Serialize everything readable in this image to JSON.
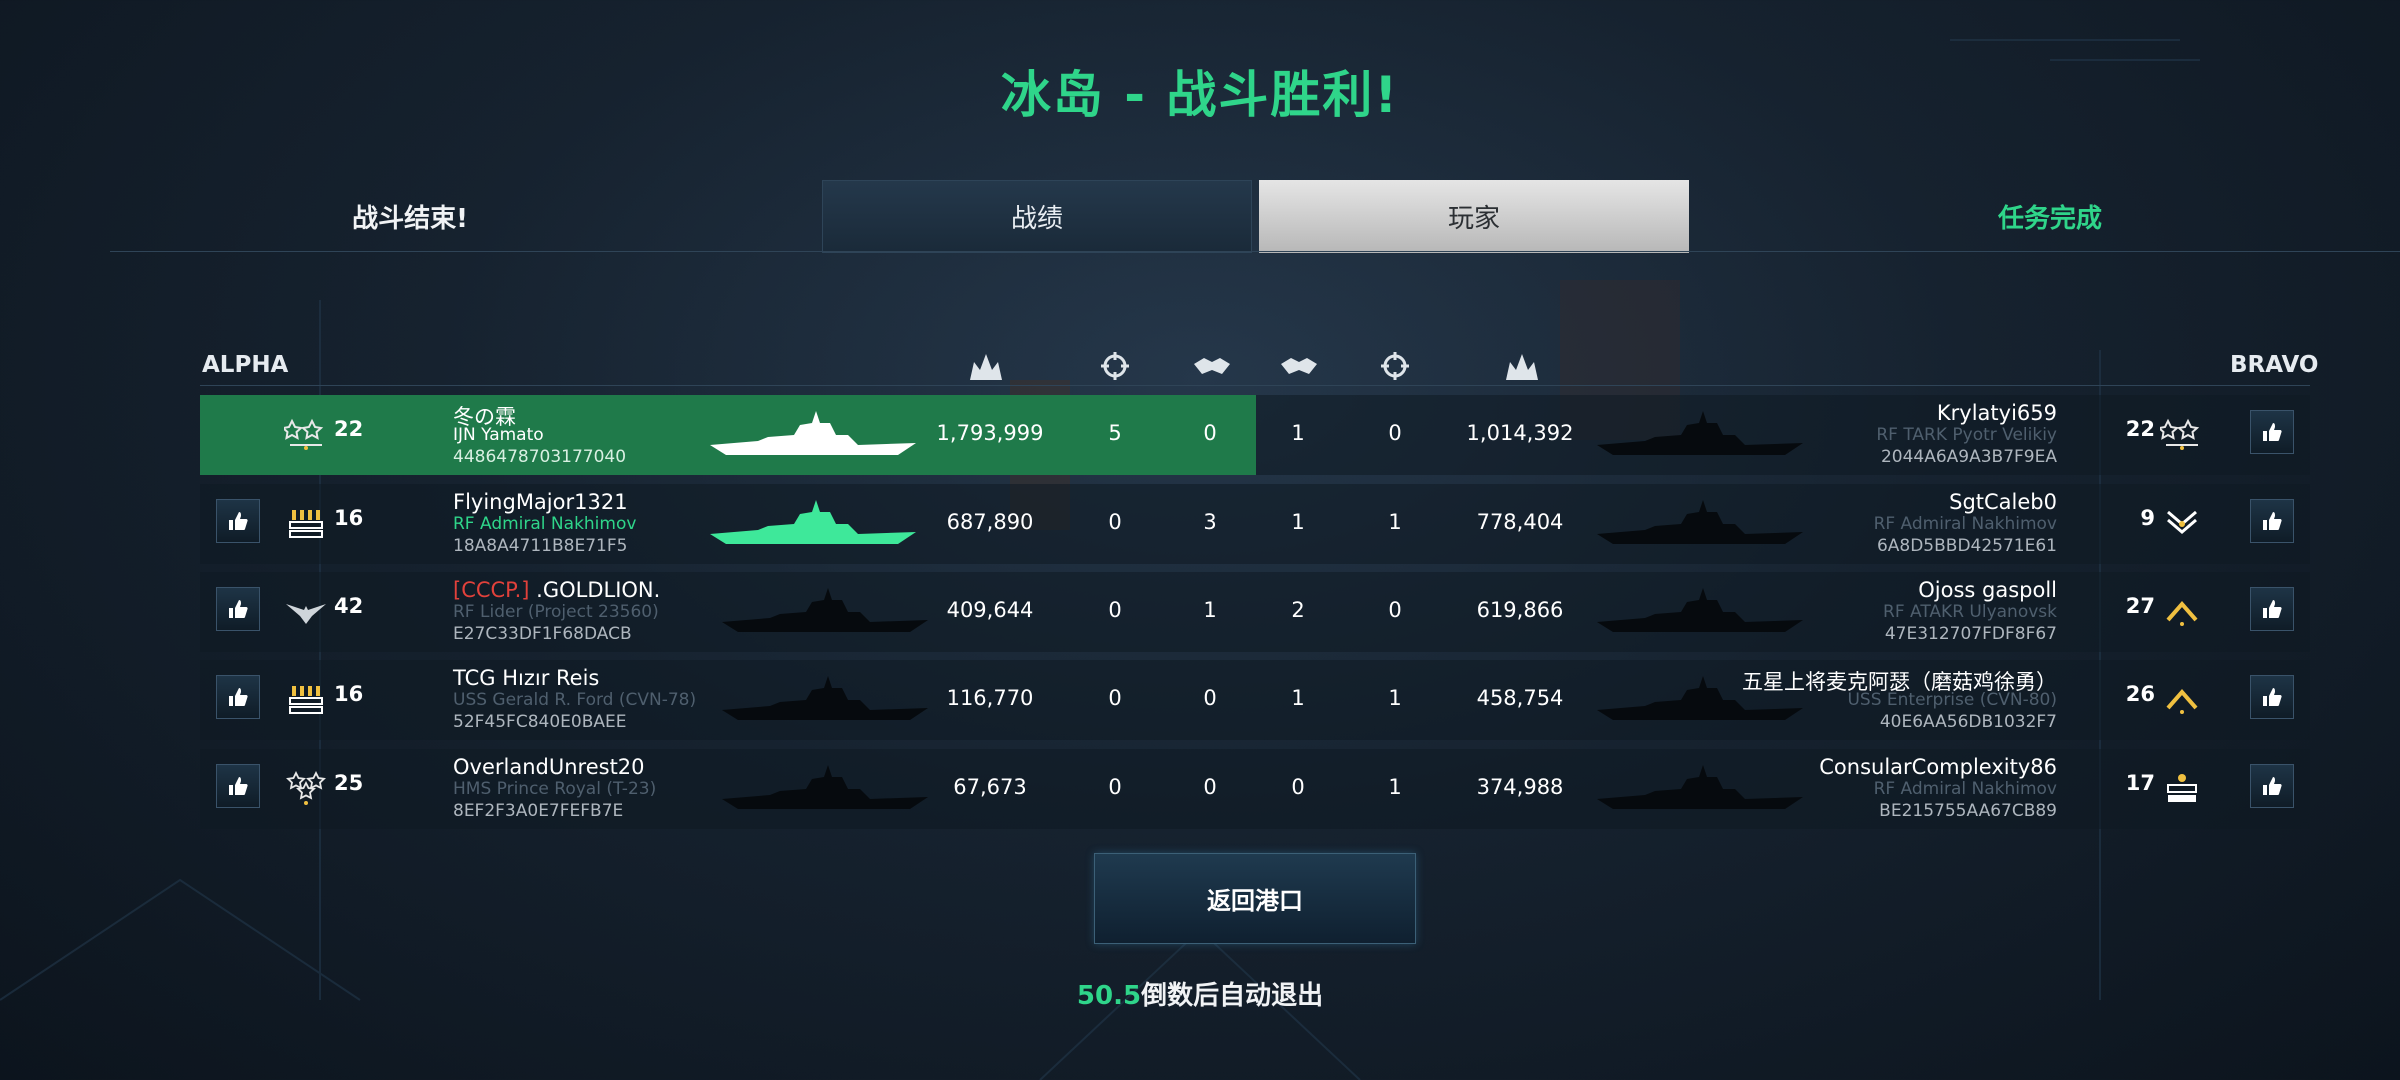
{
  "title": "冰岛 - 战斗胜利!",
  "tabs": {
    "battle_over": "战斗结束!",
    "stats": "战绩",
    "players": "玩家",
    "mission_complete": "任务完成"
  },
  "teams": {
    "left": "ALPHA",
    "right": "BRAVO"
  },
  "columns_icons": [
    "damage-icon",
    "crosshair-icon",
    "handshake-icon",
    "handshake-icon",
    "crosshair-icon",
    "damage-icon"
  ],
  "rows": [
    {
      "left": {
        "level": "22",
        "rank_icon": "two-stars-rank-icon",
        "name": "冬の霖",
        "ship": "IJN Yamato",
        "id": "4486478703177040",
        "highlight": true,
        "ship_color": "#ffffff"
      },
      "stats_left": [
        "1,793,999",
        "5",
        "0"
      ],
      "stats_right": [
        "1",
        "0",
        "1,014,392"
      ],
      "right": {
        "level": "22",
        "rank_icon": "two-stars-rank-icon",
        "name": "Krylatyi659",
        "ship": "RF TARK Pyotr Velikiy",
        "id": "2044A6A9A3B7F9EA"
      }
    },
    {
      "left": {
        "level": "16",
        "rank_icon": "bars-rank-icon",
        "name": "FlyingMajor1321",
        "ship": "RF Admiral Nakhimov",
        "id": "18A8A4711B8E71F5",
        "ship_highlight": true,
        "ship_color": "#3ee89a"
      },
      "stats_left": [
        "687,890",
        "0",
        "3"
      ],
      "stats_right": [
        "1",
        "1",
        "778,404"
      ],
      "right": {
        "level": "9",
        "rank_icon": "chevron-rank-icon",
        "name": "SgtCaleb0",
        "ship": "RF Admiral Nakhimov",
        "id": "6A8D5BBD42571E61"
      }
    },
    {
      "left": {
        "level": "42",
        "rank_icon": "winged-rank-icon",
        "clan": "[CCCP.]",
        "name": ".GOLDLION.",
        "ship": "RF Lider (Project 23560)",
        "id": "E27C33DF1F68DACB"
      },
      "stats_left": [
        "409,644",
        "0",
        "1"
      ],
      "stats_right": [
        "2",
        "0",
        "619,866"
      ],
      "right": {
        "level": "27",
        "rank_icon": "gold-chevron-rank-icon",
        "name": "Ojoss gaspoll",
        "ship": "RF ATAKR Ulyanovsk",
        "id": "47E312707FDF8F67"
      }
    },
    {
      "left": {
        "level": "16",
        "rank_icon": "bars-rank-icon",
        "name": "TCG Hızır Reis",
        "ship": "USS Gerald R. Ford (CVN-78)",
        "id": "52F45FC840E0BAEE"
      },
      "stats_left": [
        "116,770",
        "0",
        "0"
      ],
      "stats_right": [
        "1",
        "1",
        "458,754"
      ],
      "right": {
        "level": "26",
        "rank_icon": "gold-chevron-rank-icon",
        "name": "五星上将麦克阿瑟（磨菇鸡徐勇）",
        "ship": "USS Enterprise (CVN-80)",
        "id": "40E6AA56DB1032F7"
      }
    },
    {
      "left": {
        "level": "25",
        "rank_icon": "three-stars-rank-icon",
        "name": "OverlandUnrest20",
        "ship": "HMS Prince Royal (T-23)",
        "id": "8EF2F3A0E7FEFB7E"
      },
      "stats_left": [
        "67,673",
        "0",
        "0"
      ],
      "stats_right": [
        "0",
        "1",
        "374,988"
      ],
      "right": {
        "level": "17",
        "rank_icon": "insignia-rank-icon",
        "name": "ConsularComplexity86",
        "ship": "RF Admiral Nakhimov",
        "id": "BE215755AA67CB89"
      }
    }
  ],
  "back_button": "返回港口",
  "countdown": {
    "value": "50.5",
    "suffix": "倒数后自动退出"
  },
  "colors": {
    "accent_green": "#2fd58a",
    "highlight_row": "#1f7a4a",
    "clan_red": "#e2413b",
    "ship_subtext_dim": "#4f5f6e"
  }
}
